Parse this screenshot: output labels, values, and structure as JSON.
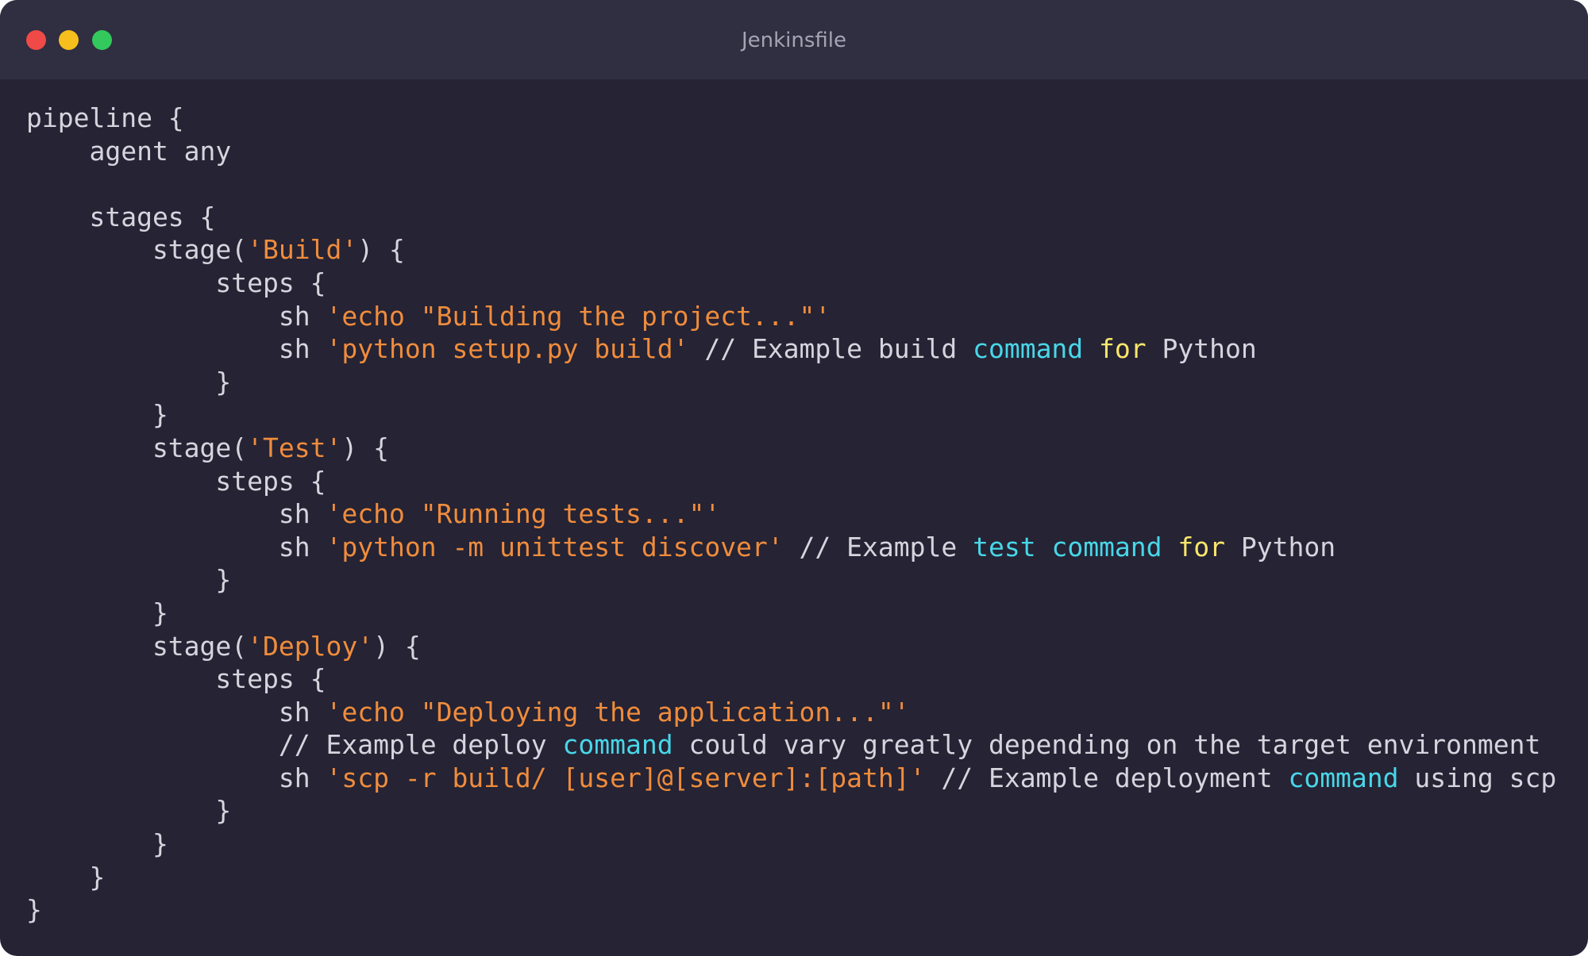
{
  "window": {
    "title": "Jenkinsfile",
    "colors": {
      "background": "#252334",
      "titlebar": "#302e41",
      "text": "#d6d4dd",
      "string": "#f08c3c",
      "keyword": "#48d7e8",
      "for_keyword": "#fce66b"
    },
    "buttons": {
      "close": "close-button",
      "minimize": "minimize-button",
      "zoom": "zoom-button"
    }
  },
  "code": {
    "lines": [
      [
        {
          "t": "pipeline {",
          "c": ""
        }
      ],
      [
        {
          "t": "    agent any",
          "c": ""
        }
      ],
      [
        {
          "t": "",
          "c": ""
        }
      ],
      [
        {
          "t": "    stages {",
          "c": ""
        }
      ],
      [
        {
          "t": "        stage(",
          "c": ""
        },
        {
          "t": "'Build'",
          "c": "str"
        },
        {
          "t": ") {",
          "c": ""
        }
      ],
      [
        {
          "t": "            steps {",
          "c": ""
        }
      ],
      [
        {
          "t": "                sh ",
          "c": ""
        },
        {
          "t": "'echo \"Building the project...\"'",
          "c": "str"
        }
      ],
      [
        {
          "t": "                sh ",
          "c": ""
        },
        {
          "t": "'python setup.py build'",
          "c": "str"
        },
        {
          "t": " // Example build ",
          "c": ""
        },
        {
          "t": "command",
          "c": "kw"
        },
        {
          "t": " ",
          "c": ""
        },
        {
          "t": "for",
          "c": "for"
        },
        {
          "t": " Python",
          "c": ""
        }
      ],
      [
        {
          "t": "            }",
          "c": ""
        }
      ],
      [
        {
          "t": "        }",
          "c": ""
        }
      ],
      [
        {
          "t": "        stage(",
          "c": ""
        },
        {
          "t": "'Test'",
          "c": "str"
        },
        {
          "t": ") {",
          "c": ""
        }
      ],
      [
        {
          "t": "            steps {",
          "c": ""
        }
      ],
      [
        {
          "t": "                sh ",
          "c": ""
        },
        {
          "t": "'echo \"Running tests...\"'",
          "c": "str"
        }
      ],
      [
        {
          "t": "                sh ",
          "c": ""
        },
        {
          "t": "'python -m unittest discover'",
          "c": "str"
        },
        {
          "t": " // Example ",
          "c": ""
        },
        {
          "t": "test",
          "c": "kw"
        },
        {
          "t": " ",
          "c": ""
        },
        {
          "t": "command",
          "c": "kw"
        },
        {
          "t": " ",
          "c": ""
        },
        {
          "t": "for",
          "c": "for"
        },
        {
          "t": " Python",
          "c": ""
        }
      ],
      [
        {
          "t": "            }",
          "c": ""
        }
      ],
      [
        {
          "t": "        }",
          "c": ""
        }
      ],
      [
        {
          "t": "        stage(",
          "c": ""
        },
        {
          "t": "'Deploy'",
          "c": "str"
        },
        {
          "t": ") {",
          "c": ""
        }
      ],
      [
        {
          "t": "            steps {",
          "c": ""
        }
      ],
      [
        {
          "t": "                sh ",
          "c": ""
        },
        {
          "t": "'echo \"Deploying the application...\"'",
          "c": "str"
        }
      ],
      [
        {
          "t": "                // Example deploy ",
          "c": ""
        },
        {
          "t": "command",
          "c": "kw"
        },
        {
          "t": " could vary greatly depending on the target environment",
          "c": ""
        }
      ],
      [
        {
          "t": "                sh ",
          "c": ""
        },
        {
          "t": "'scp -r build/ [user]@[server]:[path]'",
          "c": "str"
        },
        {
          "t": " // Example deployment ",
          "c": ""
        },
        {
          "t": "command",
          "c": "kw"
        },
        {
          "t": " using scp",
          "c": ""
        }
      ],
      [
        {
          "t": "            }",
          "c": ""
        }
      ],
      [
        {
          "t": "        }",
          "c": ""
        }
      ],
      [
        {
          "t": "    }",
          "c": ""
        }
      ],
      [
        {
          "t": "}",
          "c": ""
        }
      ]
    ]
  }
}
